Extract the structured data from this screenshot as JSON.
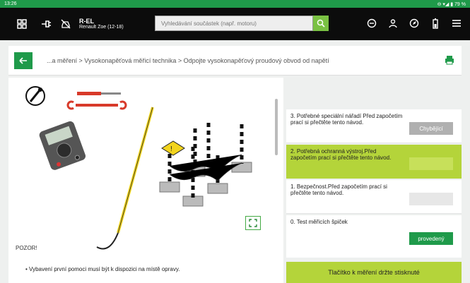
{
  "statusbar": {
    "time": "13:26",
    "right": "⊖ ▾◢ ▮ 79 %"
  },
  "vehicle": {
    "line1": "R-EL",
    "line2": "Renault Zoe (12-18)"
  },
  "search": {
    "placeholder": "Vyhledávání součástek (např. motoru)"
  },
  "breadcrumb": "...a měření > Vysokonapěťová měřicí technika > Odpojte vysokonapěťový proudový obvod od napětí",
  "left": {
    "heading": "POZOR!",
    "bullet": "Vybavení první pomoci musí být k dispozici na místě opravy."
  },
  "steps": [
    {
      "text": "3. Potřebné speciální nářadí Před započetím prací si přečtěte tento návod.",
      "button": "Chybějící",
      "state": "missing"
    },
    {
      "text": "2. Potřebná ochranná výstroj.Před započetím prací si přečtěte tento návod.",
      "button": "",
      "state": "active"
    },
    {
      "text": "1. Bezpečnost.Před započetím prací si přečtěte tento návod.",
      "button": "",
      "state": "pending"
    },
    {
      "text": "0. Test měřicích špiček",
      "button": "provedený",
      "state": "done"
    }
  ],
  "hold_button": "Tlačítko k měření držte stisknuté",
  "colors": {
    "green": "#1f9a4a",
    "lime": "#b4d43a",
    "black": "#0c0c0c"
  }
}
